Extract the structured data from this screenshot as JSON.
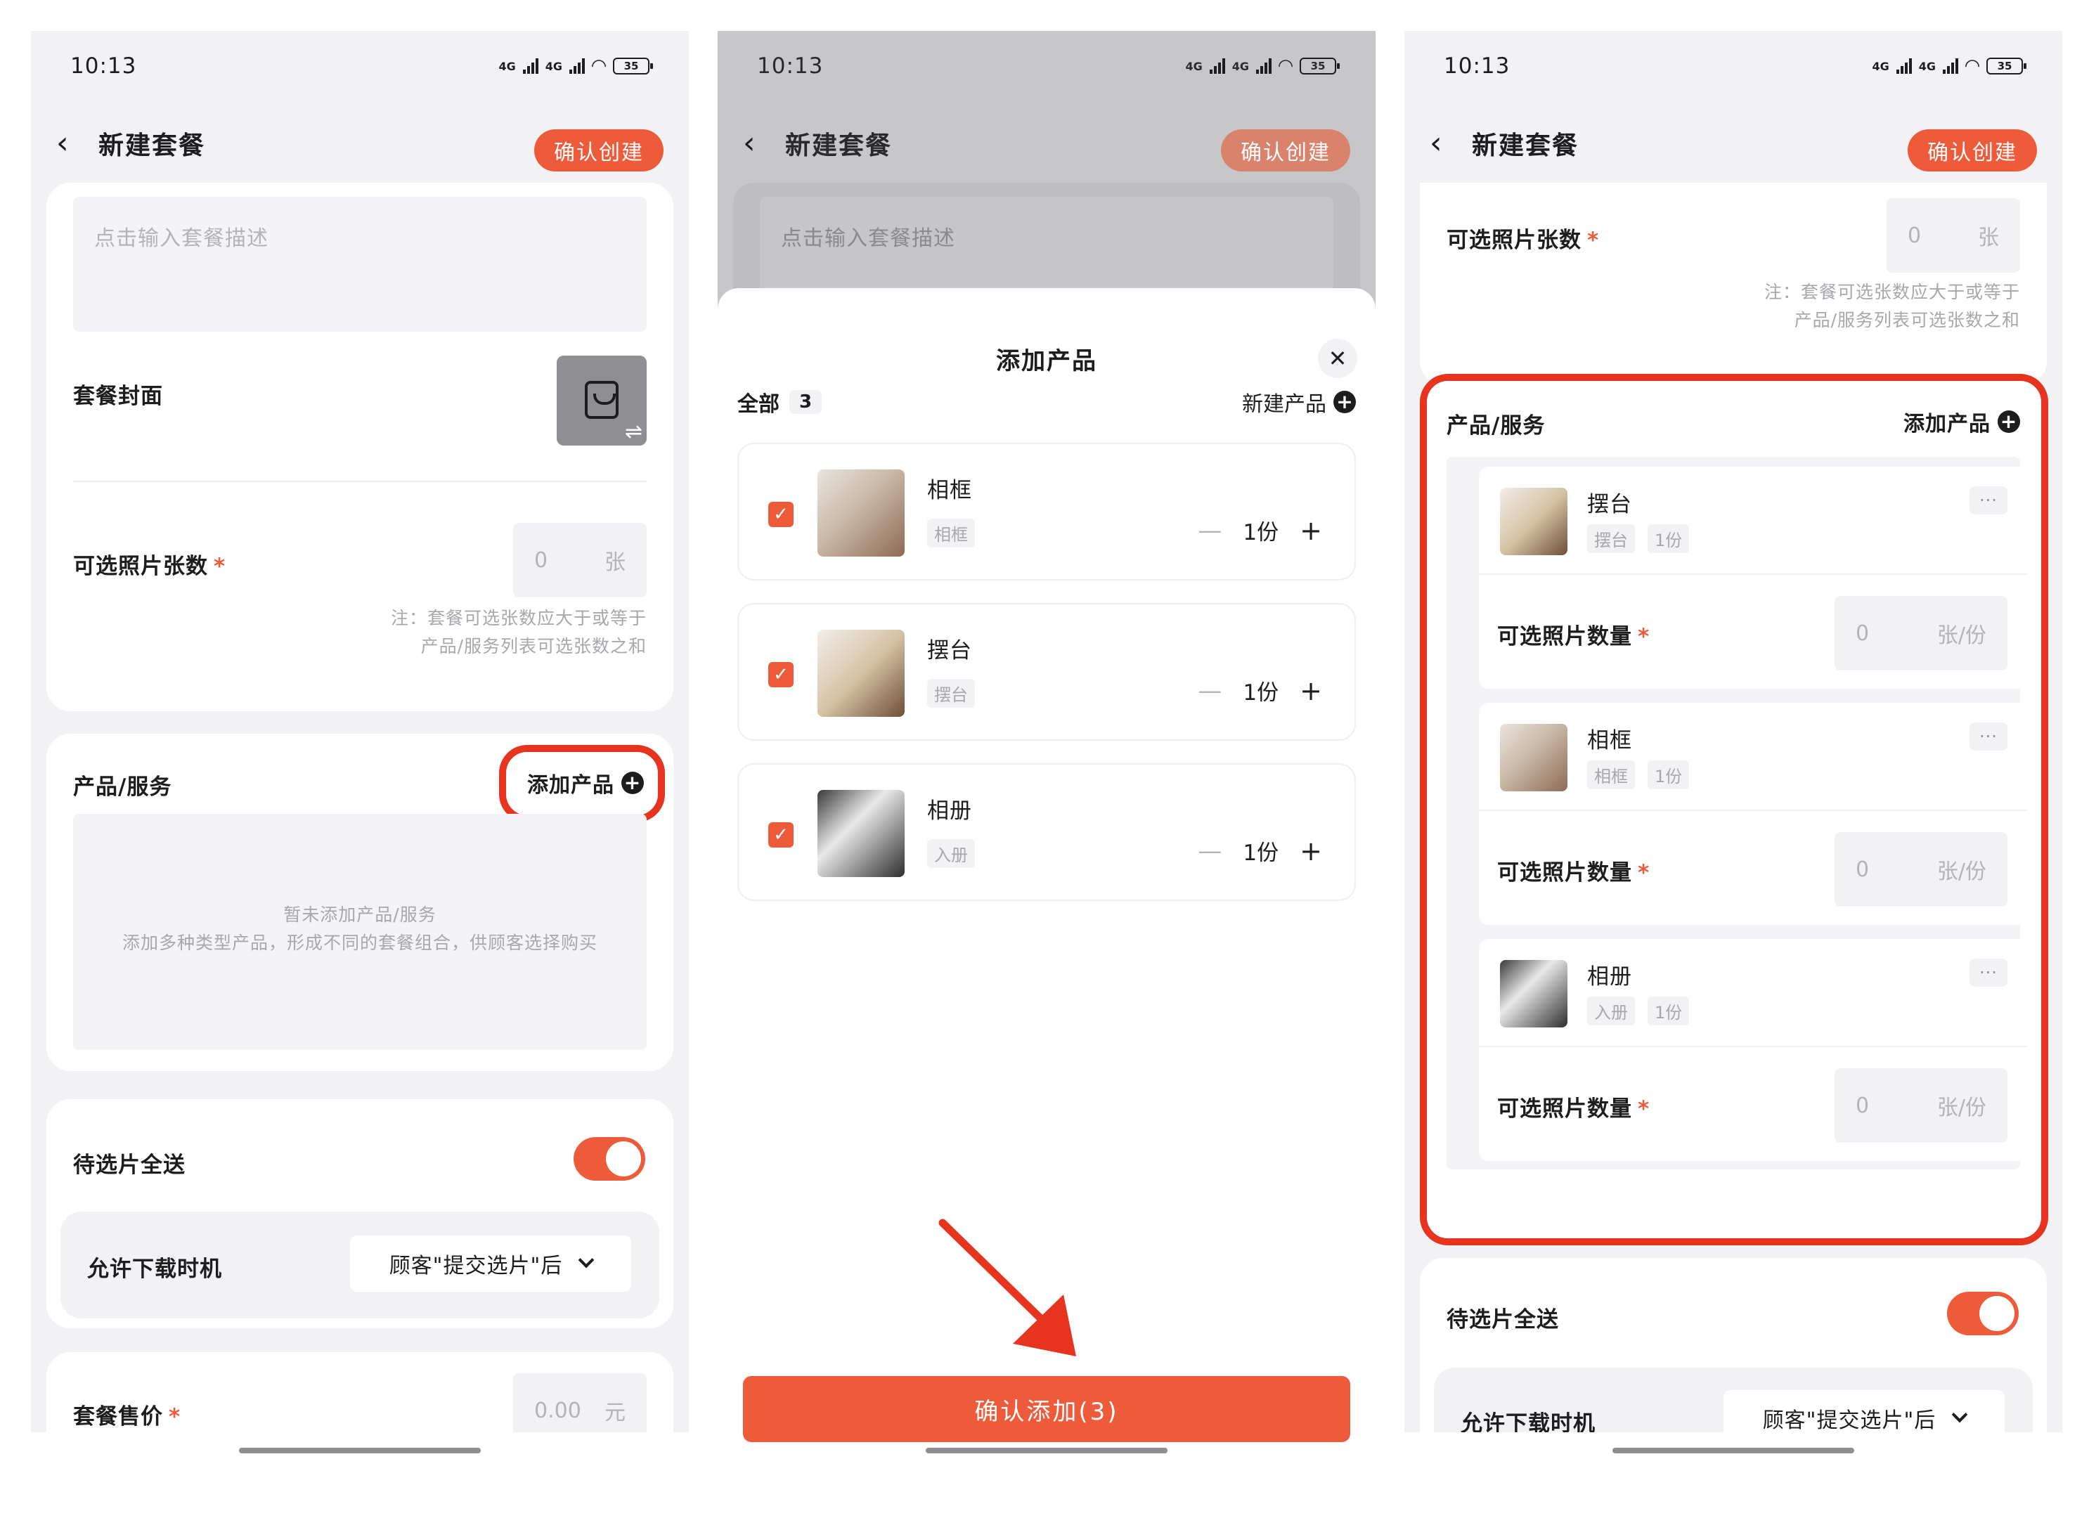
{
  "status": {
    "time": "10:13",
    "network": "4G",
    "battery": "35"
  },
  "header": {
    "title": "新建套餐",
    "confirm_label": "确认创建"
  },
  "form": {
    "desc_placeholder": "点击输入套餐描述",
    "cover_label": "套餐封面",
    "photo_count_label": "可选照片张数",
    "photo_count_value": "0",
    "photo_count_unit": "张",
    "note_line1": "注：套餐可选张数应大于或等于",
    "note_line2": "产品/服务列表可选张数之和",
    "products_label": "产品/服务",
    "add_product_label": "添加产品",
    "empty_line1": "暂未添加产品/服务",
    "empty_line2": "添加多种类型产品，形成不同的套餐组合，供顾客选择购买",
    "send_all_label": "待选片全送",
    "download_label": "允许下载时机",
    "download_value": "顾客\"提交选片\"后",
    "price_label": "套餐售价",
    "price_value": "0.00",
    "price_unit": "元"
  },
  "sheet": {
    "title": "添加产品",
    "tab_all": "全部",
    "tab_count": "3",
    "new_product": "新建产品",
    "confirm_add": "确认添加(3)",
    "items": [
      {
        "name": "相框",
        "tag": "相框",
        "qty": "1份"
      },
      {
        "name": "摆台",
        "tag": "摆台",
        "qty": "1份"
      },
      {
        "name": "相册",
        "tag": "入册",
        "qty": "1份"
      }
    ]
  },
  "list": {
    "qty_label": "可选照片数量",
    "qty_value": "0",
    "qty_unit": "张/份",
    "more": "···",
    "items": [
      {
        "name": "摆台",
        "tag": "摆台",
        "qty": "1份"
      },
      {
        "name": "相框",
        "tag": "相框",
        "qty": "1份"
      },
      {
        "name": "相册",
        "tag": "入册",
        "qty": "1份"
      }
    ]
  },
  "colors": {
    "accent": "#ee5b3a",
    "highlight": "#e6341f"
  }
}
